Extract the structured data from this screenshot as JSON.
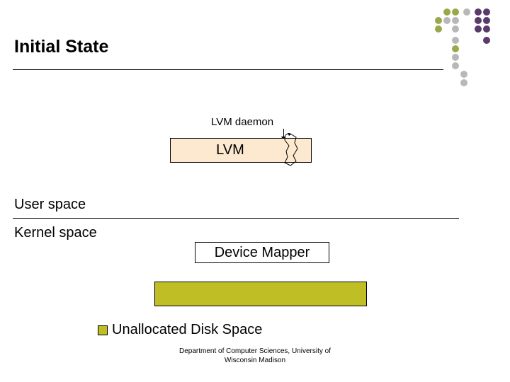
{
  "title": "Initial State",
  "labels": {
    "lvm_daemon": "LVM daemon",
    "lvm": "LVM",
    "user_space": "User space",
    "kernel_space": "Kernel space",
    "device_mapper": "Device Mapper",
    "legend": "Unallocated Disk Space"
  },
  "footer": {
    "line1": "Department of Computer Sciences, University of",
    "line2": "Wisconsin Madison"
  },
  "colors": {
    "lvm_box": "#fde9d0",
    "disk_bar": "#bfbf25",
    "decor_green": "#9aa84a",
    "decor_gray": "#b8b8b8",
    "decor_purple": "#5a3a6a"
  }
}
